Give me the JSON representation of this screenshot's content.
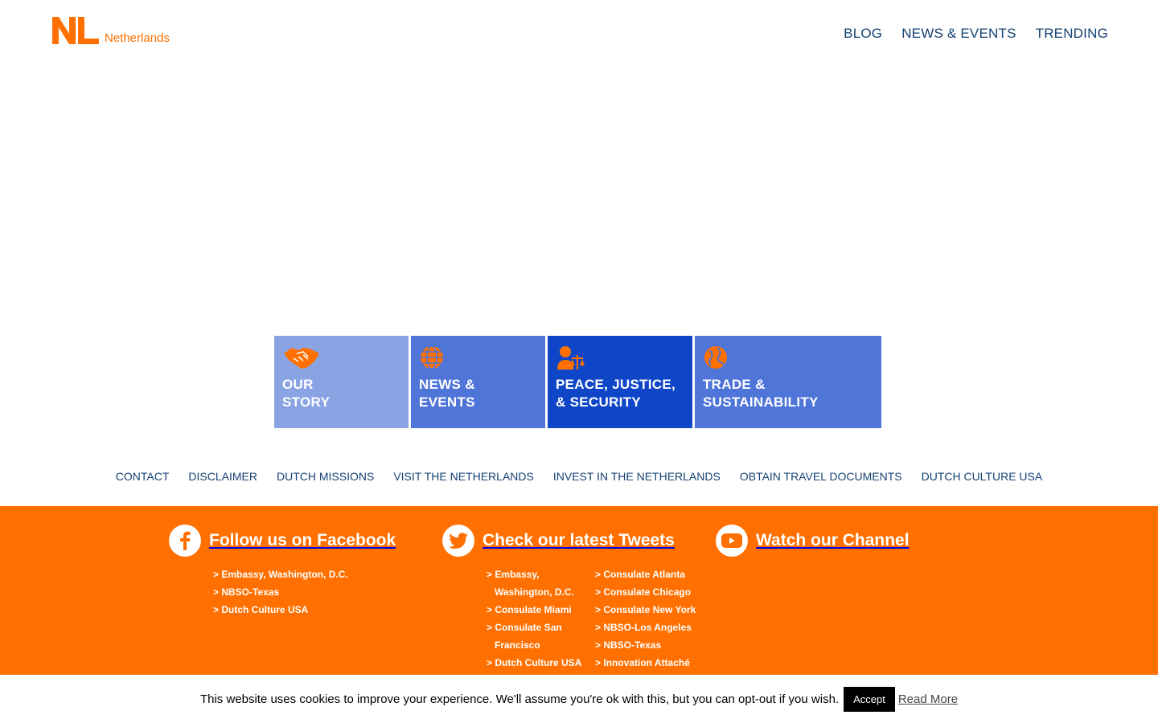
{
  "header": {
    "logo_mark": "NL",
    "logo_text": "Netherlands",
    "nav": [
      "BLOG",
      "NEWS & EVENTS",
      "TRENDING"
    ]
  },
  "tiles": [
    {
      "label": "OUR\nSTORY",
      "icon": "handshake-icon",
      "color": "#8aa4e3"
    },
    {
      "label": "NEWS &\nEVENTS",
      "icon": "globe-icon",
      "color": "#4f75d9"
    },
    {
      "label": "PEACE, JUSTICE,\n& SECURITY",
      "icon": "justice-icon",
      "color": "#0f46c8"
    },
    {
      "label": "TRADE &\nSUSTAINABILITY",
      "icon": "trade-globe-icon",
      "color": "#4f75d9"
    }
  ],
  "footer_links": [
    "CONTACT",
    "DISCLAIMER",
    "DUTCH MISSIONS",
    "VISIT THE NETHERLANDS",
    "INVEST IN THE NETHERLANDS",
    "OBTAIN TRAVEL DOCUMENTS",
    "DUTCH CULTURE USA"
  ],
  "social": {
    "facebook": {
      "title": "Follow us on Facebook",
      "links": [
        "> Embassy, Washington, D.C.",
        "> NBSO-Texas",
        "> Dutch Culture USA"
      ]
    },
    "twitter": {
      "title": "Check our latest Tweets",
      "links_col1": [
        "> Embassy, Washington, D.C.",
        "> Consulate Miami",
        "> Consulate San Francisco",
        "> Dutch Culture USA"
      ],
      "links_col2": [
        "> Consulate Atlanta",
        "> Consulate Chicago",
        "> Consulate New York",
        "> NBSO-Los Angeles",
        "> NBSO-Texas",
        "> Innovation Attaché"
      ]
    },
    "youtube": {
      "title": "Watch our Channel"
    }
  },
  "cookie": {
    "text": "This website uses cookies to improve your experience. We'll assume you're ok with this, but you can opt-out if you wish.",
    "accept": "Accept",
    "read_more": "Read More"
  },
  "colors": {
    "brand_orange": "#ff7000",
    "navy": "#154273"
  }
}
